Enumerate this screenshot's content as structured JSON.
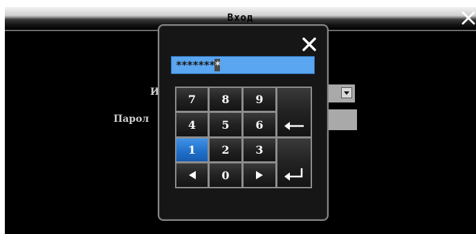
{
  "window": {
    "title": "Вход"
  },
  "form": {
    "username_label": "И",
    "password_label": "Парол"
  },
  "keypad": {
    "display_mask": "*******",
    "display_cursor_char": "*",
    "keys": {
      "k7": "7",
      "k8": "8",
      "k9": "9",
      "k4": "4",
      "k5": "5",
      "k6": "6",
      "k1": "1",
      "k2": "2",
      "k3": "3",
      "k0": "0"
    },
    "icons": {
      "backspace": "arrow-left-icon",
      "enter": "enter-icon",
      "left": "triangle-left-icon",
      "right": "triangle-right-icon",
      "close": "close-icon"
    },
    "selected_key": "1"
  },
  "colors": {
    "display": "#5aa6f0",
    "selected_key": "#1f6fc9",
    "panel": "#161616"
  }
}
